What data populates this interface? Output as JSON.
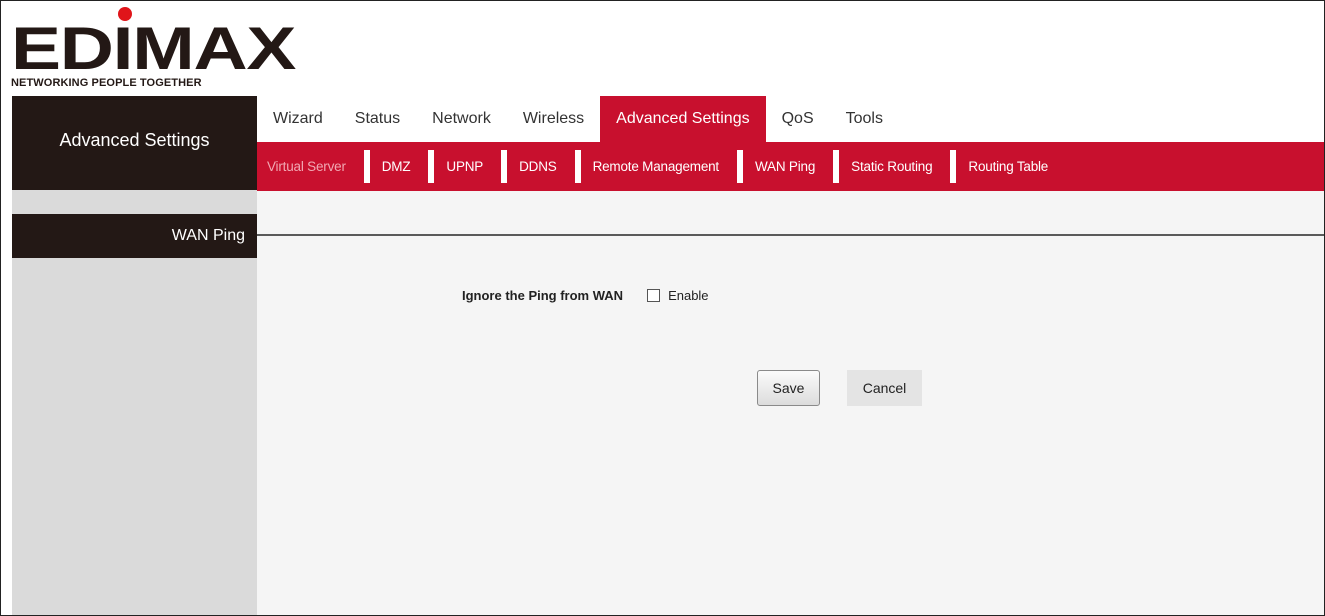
{
  "logo": {
    "brand": "EDIMAX",
    "tagline": "NETWORKING PEOPLE TOGETHER",
    "dot_color": "#e0151a"
  },
  "sidebar": {
    "title": "Advanced Settings",
    "items": [
      {
        "label": "WAN Ping",
        "selected": true
      }
    ]
  },
  "top_nav": [
    {
      "label": "Wizard"
    },
    {
      "label": "Status"
    },
    {
      "label": "Network"
    },
    {
      "label": "Wireless"
    },
    {
      "label": "Advanced Settings",
      "active": true
    },
    {
      "label": "QoS"
    },
    {
      "label": "Tools"
    }
  ],
  "sub_nav": [
    {
      "label": "Virtual Server"
    },
    {
      "label": "DMZ"
    },
    {
      "label": "UPNP"
    },
    {
      "label": "DDNS"
    },
    {
      "label": "Remote Management"
    },
    {
      "label": "WAN Ping",
      "active": true
    },
    {
      "label": "Static Routing"
    },
    {
      "label": "Routing Table"
    }
  ],
  "form": {
    "ignore_ping_label": "Ignore the Ping from WAN",
    "enable_label": "Enable",
    "enable_checked": false
  },
  "buttons": {
    "save": "Save",
    "cancel": "Cancel"
  },
  "colors": {
    "brand_red": "#c8102e",
    "dark": "#231815",
    "sidebar_bg": "#dadada"
  }
}
